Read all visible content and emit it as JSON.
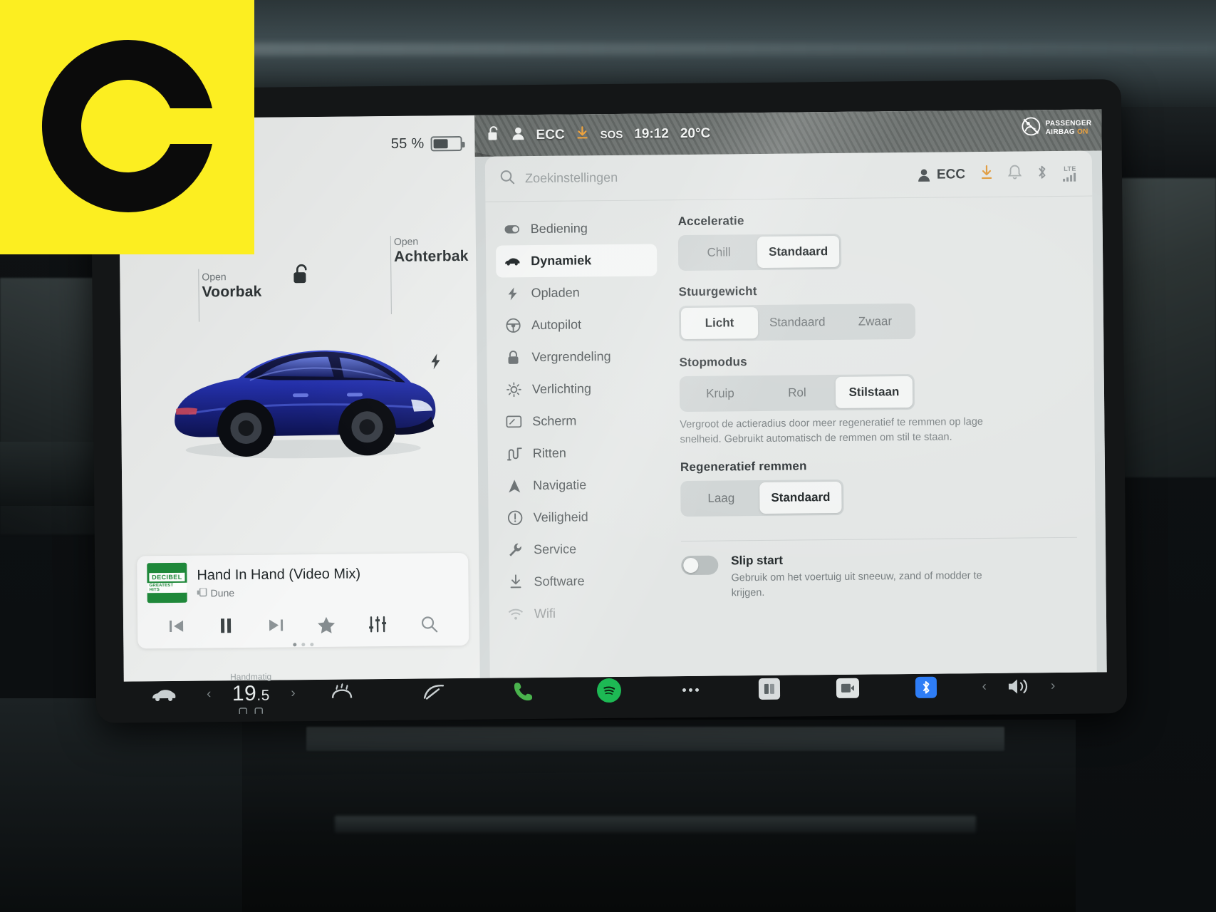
{
  "brand": {
    "logo_name": "ec-logo"
  },
  "vehicle_screen": {
    "left": {
      "battery_percent": "55 %",
      "callouts": [
        {
          "small": "Open",
          "big": "Voorbak"
        },
        {
          "small": "Open",
          "big": "Achterbak"
        }
      ],
      "icons": {
        "lock": "unlocked-padlock-icon",
        "charge": "charge-port-icon"
      }
    },
    "media": {
      "album_line1": "DECIBEL",
      "album_line2": "GREATEST HITS",
      "track_title": "Hand In Hand (Video Mix)",
      "artist": "Dune",
      "controls": [
        {
          "name": "previous-track-button",
          "glyph": "prev"
        },
        {
          "name": "pause-button",
          "glyph": "pause"
        },
        {
          "name": "next-track-button",
          "glyph": "next"
        },
        {
          "name": "favorite-button",
          "glyph": "star"
        },
        {
          "name": "equalizer-button",
          "glyph": "sliders"
        },
        {
          "name": "media-search-button",
          "glyph": "search"
        }
      ]
    },
    "statusbar": {
      "profile": "ECC",
      "sos": "SOS",
      "time": "19:12",
      "outside_temp": "20°C",
      "airbag_line1": "PASSENGER",
      "airbag_line2": "AIRBAG",
      "airbag_state": "ON"
    },
    "settings": {
      "search_placeholder": "Zoekinstellingen",
      "account": "ECC",
      "signal_label": "LTE",
      "nav_items": [
        {
          "label": "Bediening",
          "icon": "toggle-icon",
          "active": false,
          "faded": false
        },
        {
          "label": "Dynamiek",
          "icon": "car-icon",
          "active": true,
          "faded": false
        },
        {
          "label": "Opladen",
          "icon": "bolt-icon",
          "active": false,
          "faded": false
        },
        {
          "label": "Autopilot",
          "icon": "steering-wheel-icon",
          "active": false,
          "faded": false
        },
        {
          "label": "Vergrendeling",
          "icon": "lock-icon",
          "active": false,
          "faded": false
        },
        {
          "label": "Verlichting",
          "icon": "light-icon",
          "active": false,
          "faded": false
        },
        {
          "label": "Scherm",
          "icon": "display-icon",
          "active": false,
          "faded": false
        },
        {
          "label": "Ritten",
          "icon": "trips-icon",
          "active": false,
          "faded": false
        },
        {
          "label": "Navigatie",
          "icon": "navigation-arrow-icon",
          "active": false,
          "faded": false
        },
        {
          "label": "Veiligheid",
          "icon": "warning-circle-icon",
          "active": false,
          "faded": false
        },
        {
          "label": "Service",
          "icon": "wrench-icon",
          "active": false,
          "faded": false
        },
        {
          "label": "Software",
          "icon": "download-icon",
          "active": false,
          "faded": false
        },
        {
          "label": "Wifi",
          "icon": "wifi-icon",
          "active": false,
          "faded": true
        }
      ],
      "sections": [
        {
          "title": "Acceleratie",
          "options": [
            {
              "label": "Chill",
              "selected": false
            },
            {
              "label": "Standaard",
              "selected": true
            }
          ]
        },
        {
          "title": "Stuurgewicht",
          "options": [
            {
              "label": "Licht",
              "selected": true
            },
            {
              "label": "Standaard",
              "selected": false
            },
            {
              "label": "Zwaar",
              "selected": false
            }
          ]
        },
        {
          "title": "Stopmodus",
          "options": [
            {
              "label": "Kruip",
              "selected": false
            },
            {
              "label": "Rol",
              "selected": false
            },
            {
              "label": "Stilstaan",
              "selected": true
            }
          ],
          "helper": "Vergroot de actieradius door meer regeneratief te remmen op lage snelheid. Gebruikt automatisch de remmen om stil te staan."
        },
        {
          "title": "Regeneratief remmen",
          "options": [
            {
              "label": "Laag",
              "selected": false
            },
            {
              "label": "Standaard",
              "selected": true
            }
          ]
        }
      ],
      "toggle": {
        "title": "Slip start",
        "description": "Gebruik om het voertuig uit sneeuw, zand of modder te krijgen.",
        "state": "off"
      }
    },
    "taskbar": {
      "climate_mode": "Handmatig",
      "temp_int": "19",
      "temp_dec": ".5",
      "items": [
        {
          "name": "car-status-icon"
        },
        {
          "name": "defrost-icon"
        },
        {
          "name": "wiper-icon"
        },
        {
          "name": "phone-icon"
        },
        {
          "name": "spotify-icon"
        },
        {
          "name": "more-apps-icon"
        },
        {
          "name": "cards-icon"
        },
        {
          "name": "video-icon"
        },
        {
          "name": "bluetooth-icon"
        },
        {
          "name": "volume-icon"
        }
      ]
    }
  }
}
